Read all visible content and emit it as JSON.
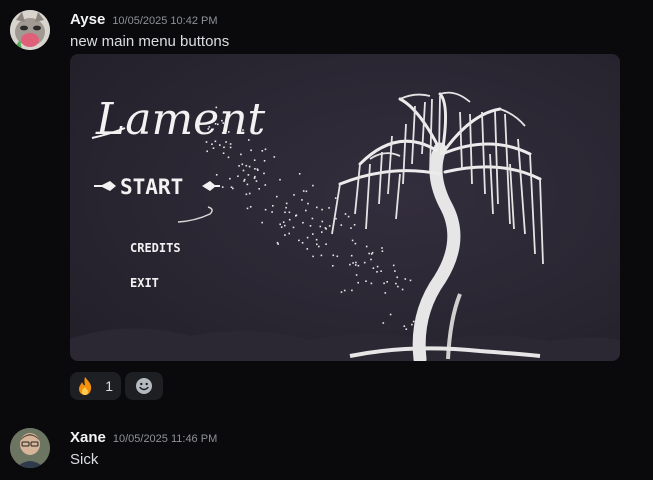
{
  "messages": [
    {
      "username": "Ayse",
      "timestamp": "10/05/2025 10:42 PM",
      "text": "new main menu buttons",
      "avatar_icon": "cat-with-tongue-avatar",
      "attachment": {
        "title": "Lament",
        "menu": {
          "start": "START",
          "credits": "CREDITS",
          "exit": "EXIT"
        },
        "background": "#27232f"
      },
      "reactions": [
        {
          "emoji": "fire-icon",
          "count": "1"
        }
      ]
    },
    {
      "username": "Xane",
      "timestamp": "10/05/2025 11:46 PM",
      "text": "Sick",
      "avatar_icon": "person-photo-avatar"
    }
  ],
  "colors": {
    "background": "#0a0a0c",
    "username": "#f2f3f5",
    "timestamp": "#8e9297",
    "text": "#dbdee1",
    "reaction_bg": "#1e1f22"
  }
}
